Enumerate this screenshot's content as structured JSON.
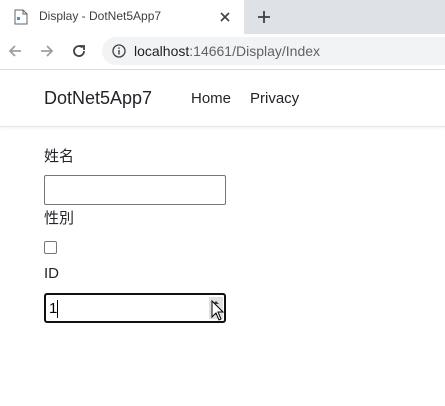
{
  "browser": {
    "tab_title": "Display - DotNet5App7",
    "url_host": "localhost",
    "url_rest": ":14661/Display/Index"
  },
  "site": {
    "brand": "DotNet5App7",
    "nav": [
      "Home",
      "Privacy"
    ]
  },
  "form": {
    "name_label": "姓名",
    "name_value": "",
    "gender_label": "性別",
    "gender_checked": false,
    "id_label": "ID",
    "id_value": "1"
  }
}
